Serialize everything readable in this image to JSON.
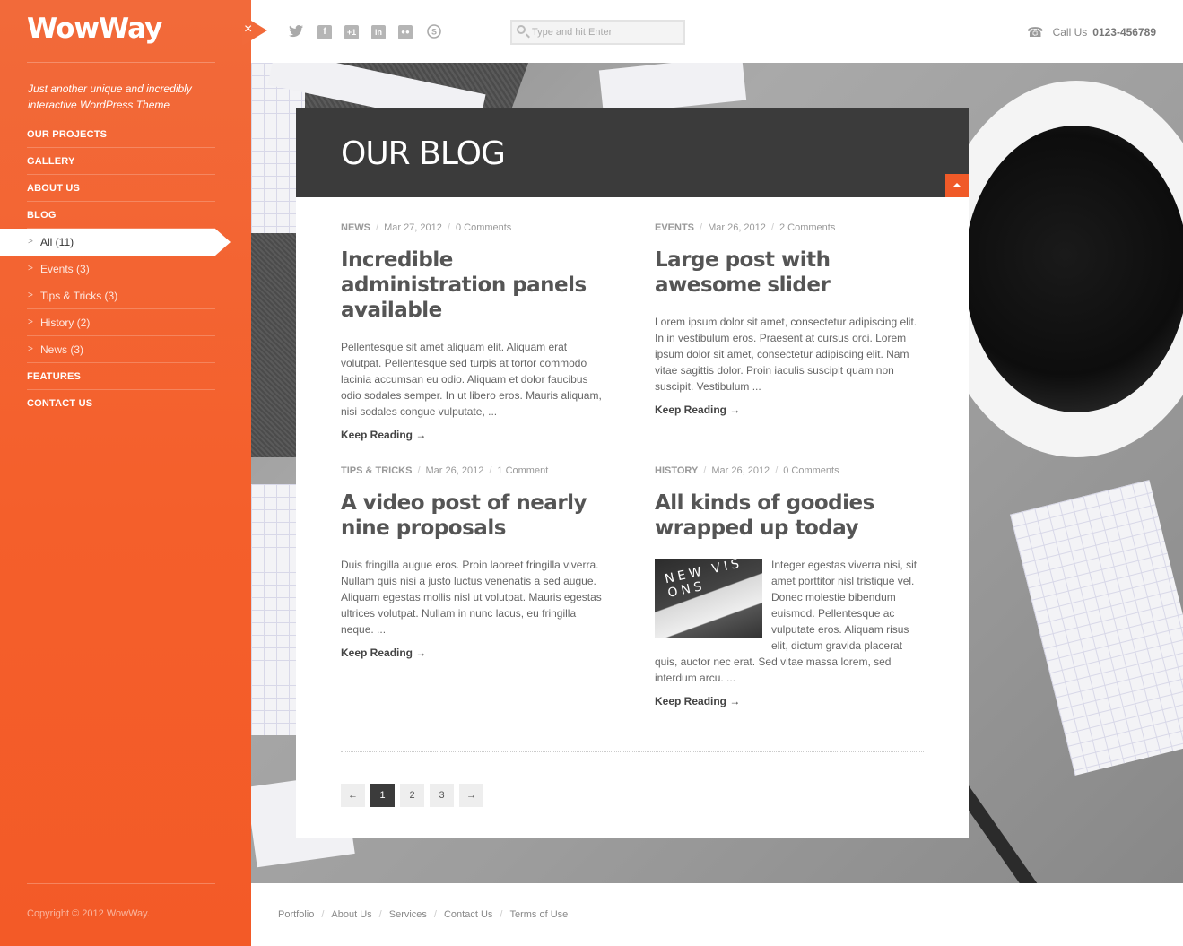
{
  "brand": {
    "logo": "WowWay",
    "tagline": "Just another unique and incredibly interactive WordPress Theme"
  },
  "nav": {
    "items": [
      {
        "label": "OUR PROJECTS"
      },
      {
        "label": "GALLERY"
      },
      {
        "label": "ABOUT US"
      },
      {
        "label": "BLOG"
      }
    ],
    "blog_sub": [
      {
        "label": "All (11)",
        "active": true
      },
      {
        "label": "Events (3)"
      },
      {
        "label": "Tips & Tricks (3)"
      },
      {
        "label": "History (2)"
      },
      {
        "label": "News (3)"
      }
    ],
    "after": [
      {
        "label": "FEATURES"
      },
      {
        "label": "CONTACT US"
      }
    ]
  },
  "copyright": "Copyright © 2012 WowWay.",
  "topbar": {
    "social": [
      "twitter-icon",
      "facebook-icon",
      "google-plus-icon",
      "linkedin-icon",
      "flickr-icon",
      "skype-icon"
    ],
    "search_placeholder": "Type and hit Enter",
    "call_label": "Call Us",
    "phone": "0123-456789"
  },
  "page": {
    "title": "OUR BLOG"
  },
  "posts": [
    {
      "category": "NEWS",
      "date": "Mar 27, 2012",
      "comments": "0 Comments",
      "title": "Incredible administration panels available",
      "excerpt": "Pellentesque sit amet aliquam elit. Aliquam erat volutpat. Pellentesque sed turpis at tortor commodo lacinia accumsan eu odio. Aliquam et dolor faucibus odio sodales semper. In ut libero eros. Mauris aliquam, nisi sodales congue vulputate, ...",
      "more": "Keep Reading →"
    },
    {
      "category": "EVENTS",
      "date": "Mar 26, 2012",
      "comments": "2 Comments",
      "title": "Large post with awesome slider",
      "excerpt": "Lorem ipsum dolor sit amet, consectetur adipiscing elit. In in vestibulum eros. Praesent at cursus orci. Lorem ipsum dolor sit amet, consectetur adipiscing elit. Nam vitae sagittis dolor. Proin iaculis suscipit quam non suscipit. Vestibulum ...",
      "more": "Keep Reading →"
    },
    {
      "category": "TIPS & TRICKS",
      "date": "Mar 26, 2012",
      "comments": "1 Comment",
      "title": "A video post of nearly nine proposals",
      "excerpt": "Duis fringilla augue eros. Proin laoreet fringilla viverra. Nullam quis nisi a justo luctus venenatis a sed augue. Aliquam egestas mollis nisl ut volutpat. Mauris egestas ultrices volutpat. Nullam in nunc lacus, eu fringilla neque. ...",
      "more": "Keep Reading →"
    },
    {
      "category": "HISTORY",
      "date": "Mar 26, 2012",
      "comments": "0 Comments",
      "title": "All kinds of goodies wrapped up today",
      "excerpt": "Integer egestas viverra nisi, sit amet porttitor nisl tristique vel. Donec molestie bibendum euismod. Pellentesque ac vulputate eros. Aliquam risus elit, dictum gravida placerat quis, auctor nec erat. Sed vitae massa lorem, sed interdum arcu. ...",
      "more": "Keep Reading →",
      "thumb_text": "NEW VIS ONS"
    }
  ],
  "pagination": {
    "prev": "←",
    "pages": [
      "1",
      "2",
      "3"
    ],
    "current": "1",
    "next": "→"
  },
  "footer": {
    "links": [
      "Portfolio",
      "About Us",
      "Services",
      "Contact Us",
      "Terms of Use"
    ]
  },
  "colors": {
    "accent": "#f26a3a",
    "header_dark": "#3b3b3b"
  }
}
